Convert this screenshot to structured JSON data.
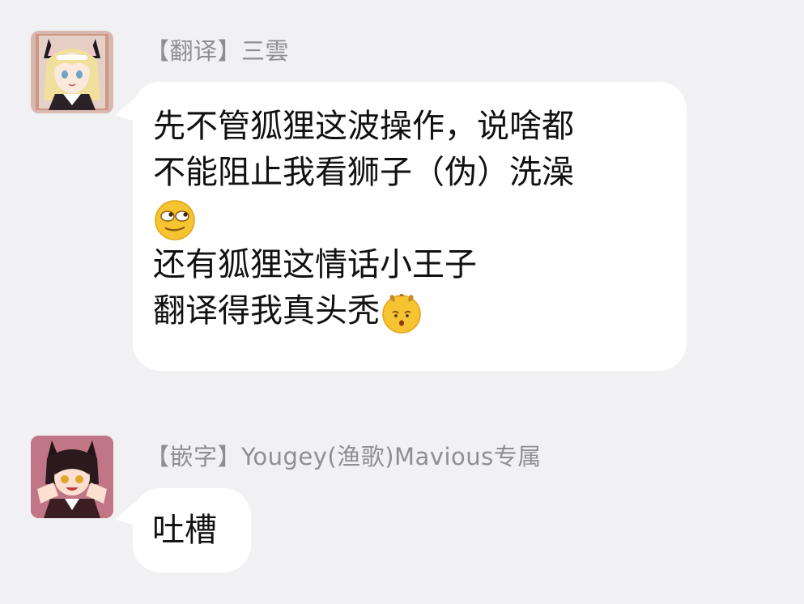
{
  "messages": [
    {
      "sender": "【翻译】三雲",
      "avatar": "anime-girl-cat-ears-avatar",
      "lines": [
        "先不管狐狸这波操作，说啥都",
        "不能阻止我看狮子（伪）洗澡",
        "",
        "还有狐狸这情话小王子",
        "翻译得我真头秃"
      ],
      "emojis": [
        "eye-roll-face-emoji",
        "bald-head-face-emoji"
      ]
    },
    {
      "sender": "【嵌字】Yougey(渔歌)Mavious专属",
      "avatar": "anime-boy-cat-ears-avatar",
      "lines": [
        "吐槽"
      ]
    }
  ],
  "colors": {
    "background": "#f1f1f3",
    "bubble": "#ffffff",
    "sender_text": "#8e8e93",
    "message_text": "#111111"
  }
}
